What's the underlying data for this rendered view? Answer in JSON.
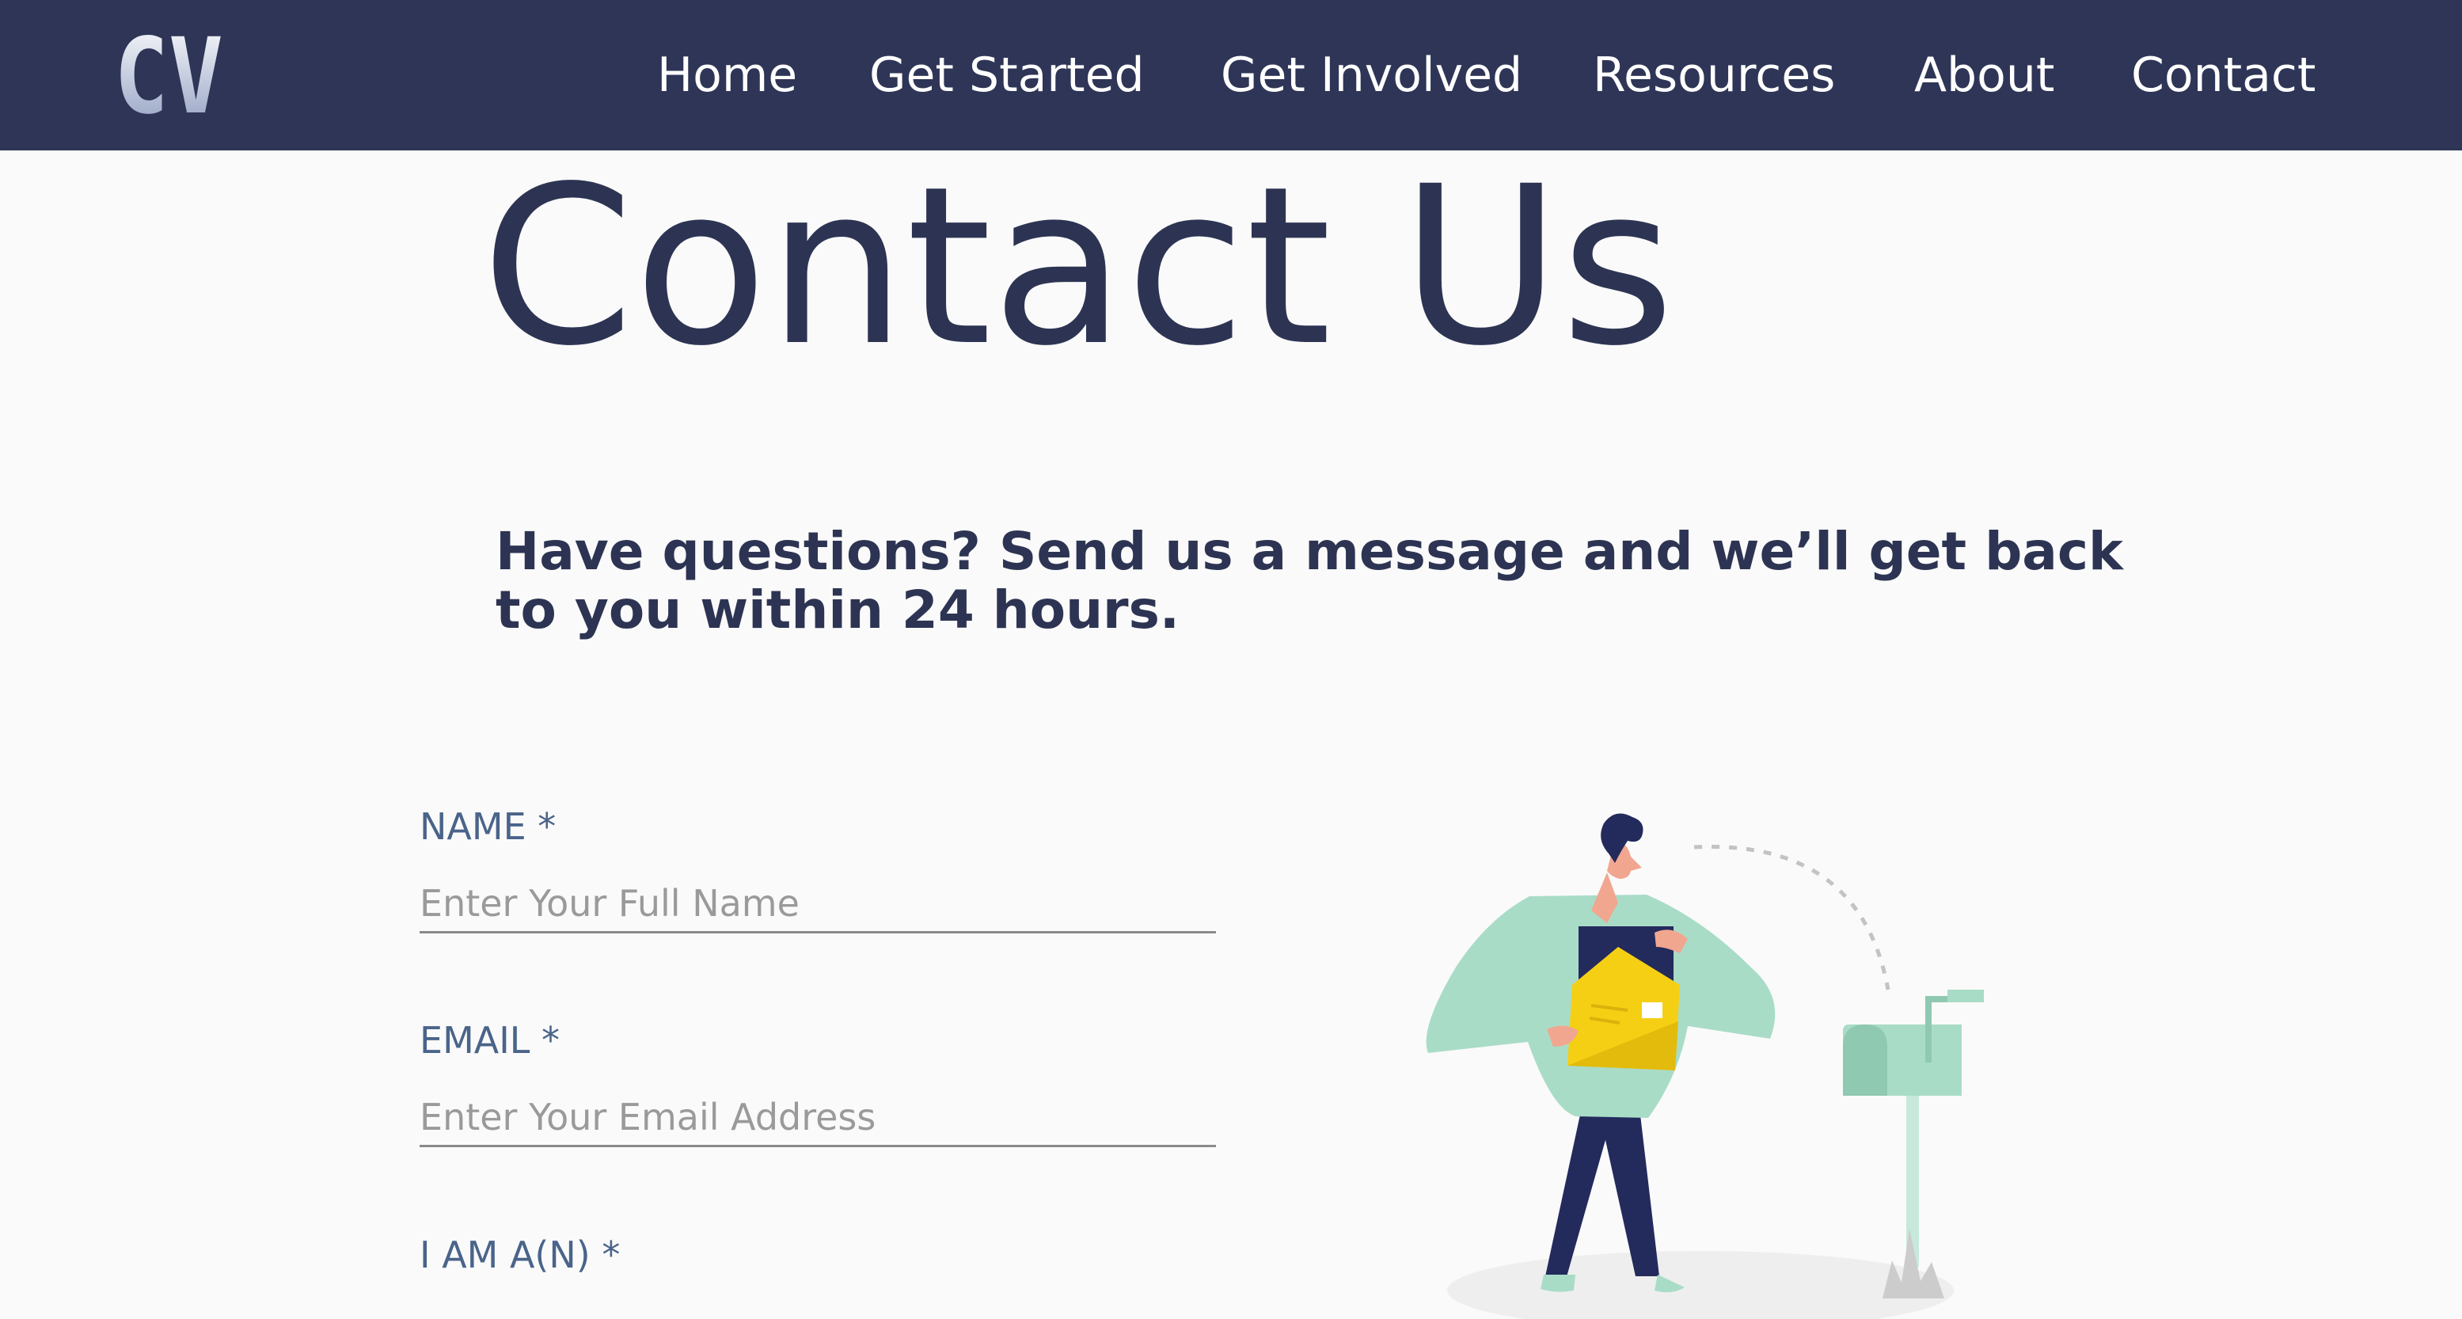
{
  "logo": {
    "text": "CV"
  },
  "nav": {
    "items": [
      {
        "label": "Home"
      },
      {
        "label": "Get Started"
      },
      {
        "label": "Get Involved"
      },
      {
        "label": "Resources"
      },
      {
        "label": "About"
      },
      {
        "label": "Contact"
      }
    ]
  },
  "main": {
    "title": "Contact Us",
    "intro": "Have questions? Send us a message and we’ll get back to you within 24 hours."
  },
  "form": {
    "name": {
      "label": "NAME *",
      "placeholder": "Enter Your Full Name",
      "value": ""
    },
    "email": {
      "label": "EMAIL *",
      "placeholder": "Enter Your Email Address",
      "value": ""
    },
    "role": {
      "label": "I AM A(N) *"
    }
  },
  "colors": {
    "navbar": "#2e3556",
    "title": "#2d3453",
    "label": "#4a648a",
    "mint": "#a9dcc7",
    "envelope": "#f5cf14"
  }
}
